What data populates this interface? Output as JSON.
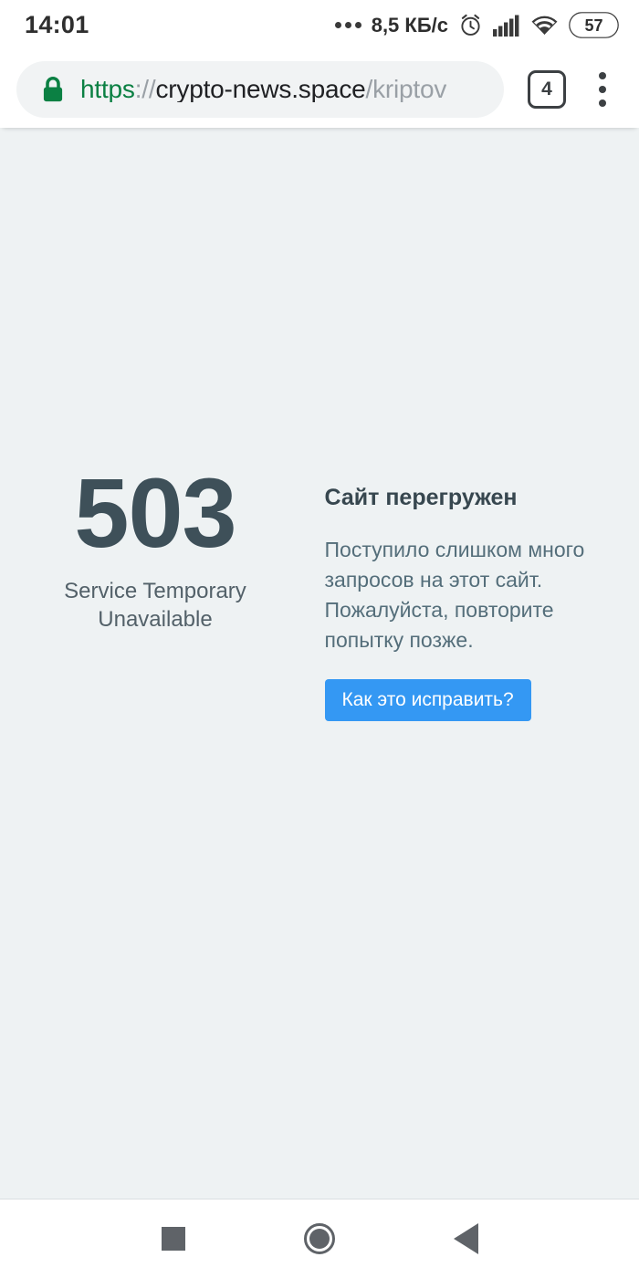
{
  "status_bar": {
    "time": "14:01",
    "overflow_icon": "more-dots-icon",
    "network_speed": "8,5 КБ/c",
    "alarm_icon": "alarm-clock-icon",
    "signal_icon": "cellular-signal-icon",
    "wifi_icon": "wifi-icon",
    "battery_level": "57"
  },
  "browser": {
    "lock_icon": "lock-icon",
    "url": {
      "scheme": "https",
      "separator": "://",
      "host": "crypto-news.space",
      "path": "/kriptov",
      "full": "https://crypto-news.space/kriptov"
    },
    "tab_count": "4",
    "menu_icon": "overflow-menu-icon"
  },
  "page": {
    "code": "503",
    "code_subtitle_line1": "Service Temporary",
    "code_subtitle_line2": "Unavailable",
    "title": "Сайт перегружен",
    "body": "Поступило слишком много запросов на этот сайт. Пожалуйста, повторите попытку позже.",
    "button_label": "Как это исправить?"
  },
  "nav_bar": {
    "recents_icon": "recents-square-icon",
    "home_icon": "home-circle-icon",
    "back_icon": "back-triangle-icon"
  },
  "colors": {
    "page_background": "#eef2f3",
    "code_text": "#3e5059",
    "title_text": "#37474f",
    "body_text": "#546e7a",
    "button_blue": "#3498f3",
    "lock_green": "#0b8043",
    "url_host": "#202124",
    "url_muted": "#9aa0a6",
    "omnibox_background": "#f1f3f4",
    "nav_icon": "#5f6368"
  }
}
